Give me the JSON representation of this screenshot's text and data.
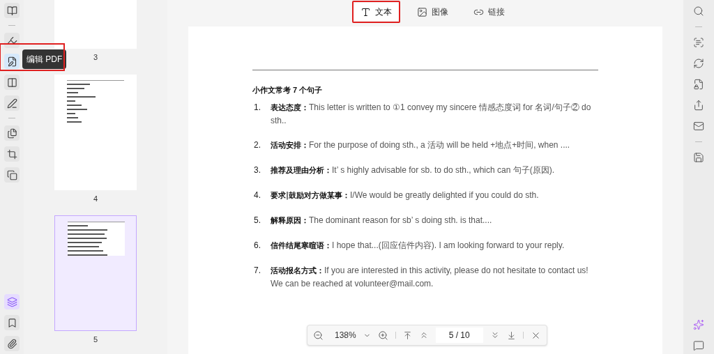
{
  "left_toolbar": {
    "tools": [
      {
        "kind": "reader",
        "selected": false
      },
      {
        "kind": "highlighter",
        "selected": false
      },
      {
        "kind": "edit",
        "selected": true,
        "tooltip": "编辑 PDF"
      },
      {
        "kind": "form",
        "selected": false
      },
      {
        "kind": "sign",
        "selected": false
      },
      {
        "kind": "pages",
        "selected": false
      },
      {
        "kind": "crop",
        "selected": false
      },
      {
        "kind": "copy",
        "selected": false
      }
    ],
    "bottom": [
      {
        "kind": "layers",
        "selected": true
      },
      {
        "kind": "bookmark",
        "selected": false
      },
      {
        "kind": "attachment",
        "selected": false
      }
    ]
  },
  "thumbnails": [
    {
      "label": "3",
      "kind": "blank",
      "selected": false
    },
    {
      "label": "4",
      "kind": "table",
      "selected": false
    },
    {
      "label": "5",
      "kind": "list",
      "selected": true
    }
  ],
  "edit_tabs": [
    {
      "label": "文本",
      "kind": "text",
      "selected": true
    },
    {
      "label": "图像",
      "kind": "image",
      "selected": false
    },
    {
      "label": "链接",
      "kind": "link",
      "selected": false
    }
  ],
  "document": {
    "heading": "小作文常考 7 个句子",
    "items": [
      {
        "number": "1.",
        "label": "表达态度：",
        "text": "This letter is written to ①1 convey my sincere 情感态度词 for 名词/句子② do sth.."
      },
      {
        "number": "2.",
        "label": "活动安排：",
        "text": "For the purpose of doing sth., a 活动 will be held +地点+时间, when ...."
      },
      {
        "number": "3.",
        "label": "推荐及理由分析：",
        "text": "It’ s highly advisable for sb. to do sth., which can 句子(原因)."
      },
      {
        "number": "4.",
        "label": "要求|鼓励对方做某事：",
        "text": "I/We would be greatly delighted if you could do sth."
      },
      {
        "number": "5.",
        "label": "解释原因：",
        "text": "The dominant reason for sb’ s doing sth. is that...."
      },
      {
        "number": "6.",
        "label": "信件结尾寒暄语：",
        "text": "I hope that...(回应信件内容). I am looking forward to your reply."
      },
      {
        "number": "7.",
        "label": "活动报名方式：",
        "text": "If you are interested in this activity, please do not hesitate to contact us! We can be reached at volunteer@mail.com."
      }
    ]
  },
  "zoom_bar": {
    "zoom": "138%",
    "page": "5 / 10"
  },
  "right_toolbar": {
    "tools": [
      {
        "kind": "search"
      },
      {
        "kind": "ocr"
      },
      {
        "kind": "convert"
      },
      {
        "kind": "protect"
      },
      {
        "kind": "share"
      },
      {
        "kind": "mail"
      },
      {
        "kind": "save"
      },
      {
        "kind": "ai"
      },
      {
        "kind": "comment"
      }
    ]
  }
}
